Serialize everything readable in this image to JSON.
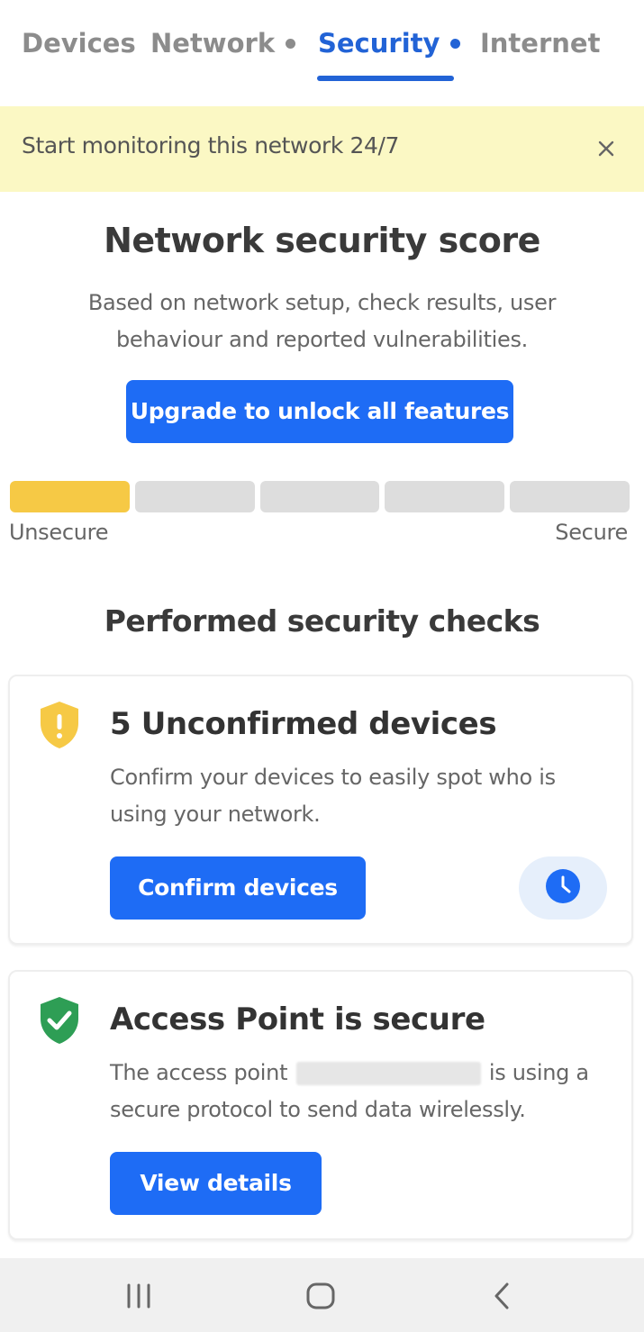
{
  "tabs": [
    {
      "label": "Devices",
      "active": false,
      "dot": false
    },
    {
      "label": "Network",
      "active": false,
      "dot": true
    },
    {
      "label": "Security",
      "active": true,
      "dot": true
    },
    {
      "label": "Internet",
      "active": false,
      "dot": false
    }
  ],
  "banner": {
    "text": "Start monitoring this network 24/7",
    "close_icon": "close-icon"
  },
  "score": {
    "title": "Network security score",
    "description": "Based on network setup, check results, user behaviour and reported vulnerabilities.",
    "upgrade_label": "Upgrade to unlock all features",
    "meter_segments_total": 5,
    "meter_segments_filled": 1,
    "low_label": "Unsecure",
    "high_label": "Secure"
  },
  "checks": {
    "title": "Performed security checks",
    "items": [
      {
        "icon": "warning-shield-icon",
        "title": "5 Unconfirmed devices",
        "text": "Confirm your devices to easily spot who is using your network.",
        "button_label": "Confirm devices",
        "secondary_icon": "clock-icon"
      },
      {
        "icon": "check-shield-icon",
        "title": "Access Point is secure",
        "text_before": "The access point",
        "text_after": "is using a secure protocol to send data wirelessly.",
        "button_label": "View details"
      }
    ]
  },
  "colors": {
    "accent": "#1e6cf5",
    "tab_active": "#2263d6",
    "banner_bg": "#fbf8c4",
    "meter_filled": "#f6c945",
    "warning": "#f6c945",
    "success": "#2e9e55"
  },
  "navbar": {
    "icons": [
      "recent-apps-icon",
      "home-icon",
      "back-icon"
    ]
  }
}
